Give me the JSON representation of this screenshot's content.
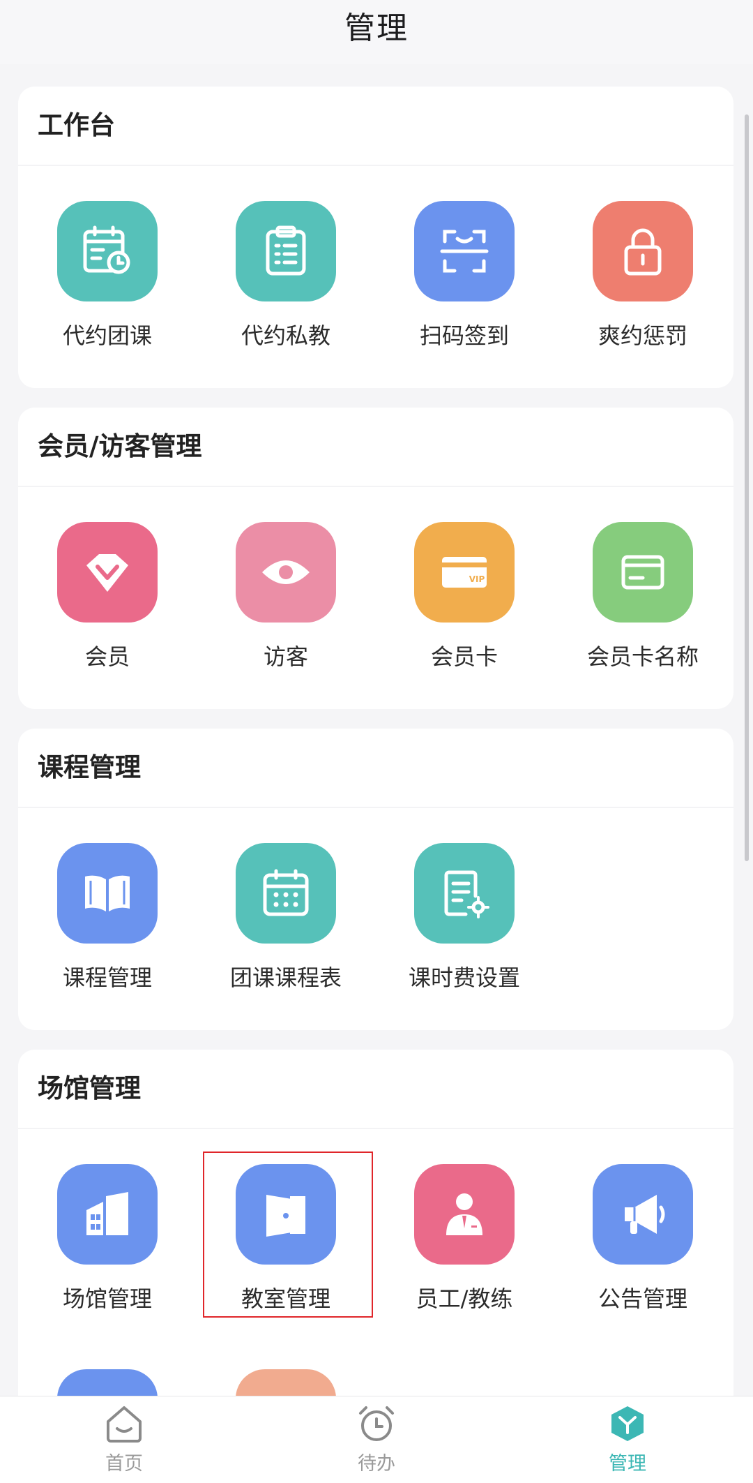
{
  "header": {
    "title": "管理"
  },
  "sections": [
    {
      "title": "工作台",
      "items": [
        {
          "label": "代约团课",
          "icon": "calendar-clock-icon",
          "color": "#56c1b9"
        },
        {
          "label": "代约私教",
          "icon": "clipboard-list-icon",
          "color": "#56c1b9"
        },
        {
          "label": "扫码签到",
          "icon": "scan-icon",
          "color": "#6b93ee"
        },
        {
          "label": "爽约惩罚",
          "icon": "lock-icon",
          "color": "#ee7e6f"
        }
      ]
    },
    {
      "title": "会员/访客管理",
      "items": [
        {
          "label": "会员",
          "icon": "diamond-icon",
          "color": "#ea6a8a"
        },
        {
          "label": "访客",
          "icon": "eye-icon",
          "color": "#eb8ea6"
        },
        {
          "label": "会员卡",
          "icon": "vip-card-icon",
          "color": "#f1ad4d",
          "badge": "VIP"
        },
        {
          "label": "会员卡名称",
          "icon": "card-icon",
          "color": "#86cc7d"
        }
      ]
    },
    {
      "title": "课程管理",
      "items": [
        {
          "label": "课程管理",
          "icon": "book-icon",
          "color": "#6b93ee"
        },
        {
          "label": "团课课程表",
          "icon": "calendar-grid-icon",
          "color": "#56c1b9"
        },
        {
          "label": "课时费设置",
          "icon": "document-gear-icon",
          "color": "#56c1b9"
        }
      ]
    },
    {
      "title": "场馆管理",
      "items": [
        {
          "label": "场馆管理",
          "icon": "building-icon",
          "color": "#6b93ee"
        },
        {
          "label": "教室管理",
          "icon": "door-icon",
          "color": "#6b93ee"
        },
        {
          "label": "员工/教练",
          "icon": "staff-icon",
          "color": "#ea6a8a"
        },
        {
          "label": "公告管理",
          "icon": "megaphone-icon",
          "color": "#6b93ee"
        }
      ]
    }
  ],
  "partial_row": [
    {
      "icon": "partial-icon",
      "color": "#6b93ee"
    },
    {
      "icon": "partial-icon",
      "color": "#f1ab8f"
    }
  ],
  "tabbar": [
    {
      "label": "首页",
      "icon": "home-icon",
      "active": false
    },
    {
      "label": "待办",
      "icon": "alarm-clock-icon",
      "active": false
    },
    {
      "label": "管理",
      "icon": "manage-cube-icon",
      "active": true,
      "accent": "#3cb7b4"
    }
  ]
}
